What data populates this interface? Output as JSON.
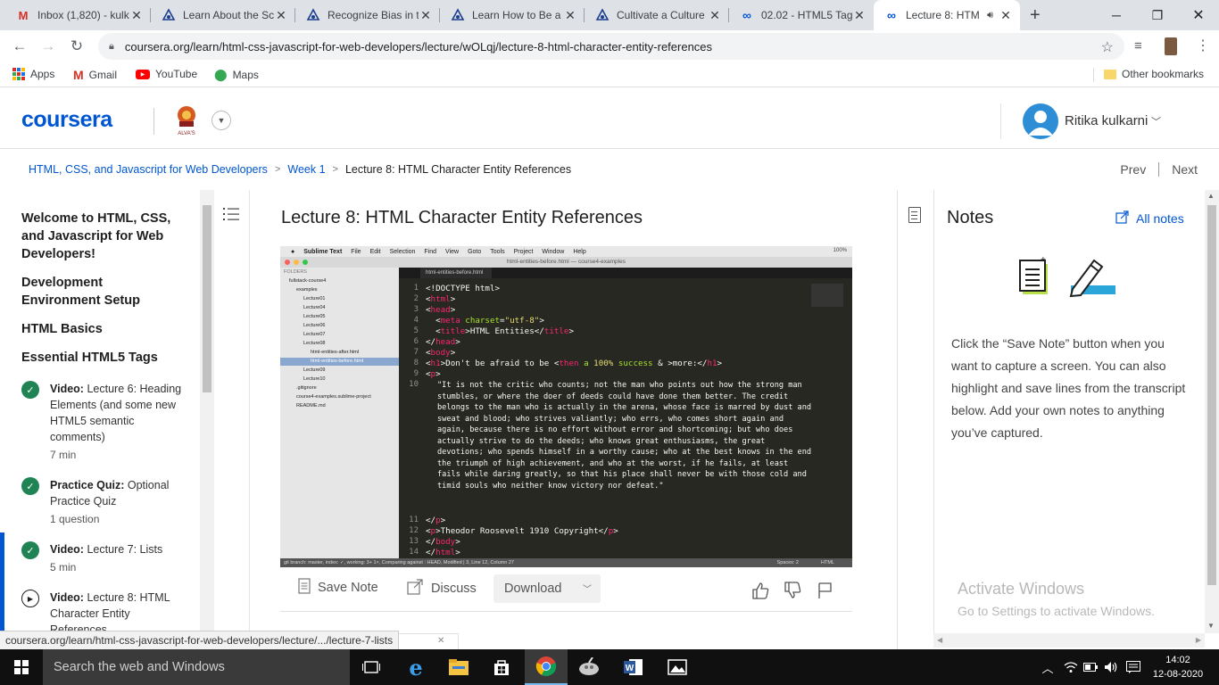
{
  "browser": {
    "tabs": [
      {
        "title": "Inbox (1,820) - kulk",
        "favicon": "gmail-icon"
      },
      {
        "title": "Learn About the Sc",
        "favicon": "coursera-badge-icon"
      },
      {
        "title": "Recognize Bias in t",
        "favicon": "coursera-badge-icon"
      },
      {
        "title": "Learn How to Be a",
        "favicon": "coursera-badge-icon"
      },
      {
        "title": "Cultivate a Culture",
        "favicon": "coursera-badge-icon"
      },
      {
        "title": "02.02 - HTML5 Tag",
        "favicon": "coursera-loop-icon"
      },
      {
        "title": "Lecture 8: HTM",
        "favicon": "coursera-loop-icon",
        "active": true
      }
    ],
    "new_tab_glyph": "+",
    "url": "coursera.org/learn/html-css-javascript-for-web-developers/lecture/wOLqj/lecture-8-html-character-entity-references",
    "bookmarks": [
      "Apps",
      "Gmail",
      "YouTube",
      "Maps"
    ],
    "other_bookmarks": "Other bookmarks"
  },
  "header": {
    "logo": "coursera",
    "institution": "ALVA'S",
    "user_name": "Ritika kulkarni"
  },
  "breadcrumb": {
    "course": "HTML, CSS, and Javascript for Web Developers",
    "week": "Week 1",
    "current": "Lecture 8: HTML Character Entity References",
    "prev": "Prev",
    "next": "Next"
  },
  "sidebar": {
    "sections": [
      "Welcome to HTML, CSS, and Javascript for Web Developers!",
      "Development Environment Setup",
      "HTML Basics",
      "Essential HTML5 Tags"
    ],
    "items": [
      {
        "kind": "Video:",
        "title": "Lecture 6: Heading Elements (and some new HTML5 semantic comments)",
        "meta": "7 min",
        "status": "done"
      },
      {
        "kind": "Practice Quiz:",
        "title": "Optional Practice Quiz",
        "meta": "1 question",
        "status": "done"
      },
      {
        "kind": "Video:",
        "title": "Lecture 7: Lists",
        "meta": "5 min",
        "status": "done"
      },
      {
        "kind": "Video:",
        "title": "Lecture 8: HTML Character Entity References",
        "meta": "",
        "status": "current"
      }
    ]
  },
  "lecture": {
    "title": "Lecture 8: HTML Character Entity References",
    "video": {
      "menubar": [
        "Sublime Text",
        "File",
        "Edit",
        "Selection",
        "Find",
        "View",
        "Goto",
        "Tools",
        "Project",
        "Window",
        "Help"
      ],
      "menubar_right": "100%",
      "window_title": "html-entities-before.html — course4-examples",
      "folders_header": "FOLDERS",
      "folders": [
        "fullstack-course4",
        "examples",
        "Lecture01",
        "Lecture04",
        "Lecture05",
        "Lecture06",
        "Lecture07",
        "Lecture08",
        "html-entities-after.html",
        "html-entities-before.html",
        "Lecture09",
        "Lecture10",
        ".gitignore",
        "course4-examples.sublime-project",
        "README.md"
      ],
      "editor_tab": "html-entities-before.html",
      "line_numbers": [
        "1",
        "2",
        "3",
        "4",
        "5",
        "6",
        "7",
        "8",
        "9",
        "10",
        "11",
        "12",
        "13",
        "14"
      ],
      "quote": "\"It is not the critic who counts; not the man who points out how the strong man stumbles, or where the doer of deeds could have done them better. The credit belongs to the man who is actually in the arena, whose face is marred by dust and sweat and blood; who strives valiantly; who errs, who comes short again and again, because there is no effort without error and shortcoming; but who does actually strive to do the deeds; who knows great enthusiasms, the great devotions; who spends himself in a worthy cause; who at the best knows in the end the triumph of high achievement, and who at the worst, if he fails, at least fails while daring greatly, so that his place shall never be with those cold and timid souls who neither know victory nor defeat.\"",
      "status_left": "git branch: master, index: ✓, working: 3+ 1×, Comparing against : HEAD, Modified | 3, Line 12, Column 27",
      "status_spaces": "Spaces: 2",
      "status_syntax": "HTML"
    },
    "actions": {
      "save_note": "Save Note",
      "discuss": "Discuss",
      "download": "Download"
    }
  },
  "notes": {
    "title": "Notes",
    "all_notes": "All notes",
    "help_text": "Click the “Save Note” button when you want to capture a screen. You can also highlight and save lines from the transcript below. Add your own notes to anything you’ve captured."
  },
  "watermark": {
    "line1": "Activate Windows",
    "line2": "Go to Settings to activate Windows."
  },
  "status_url": "coursera.org/learn/html-css-javascript-for-web-developers/lecture/.../lecture-7-lists",
  "taskbar": {
    "search_placeholder": "Search the web and Windows",
    "time": "14:02",
    "date": "12-08-2020"
  },
  "colors": {
    "coursera_blue": "#0056d2",
    "done_green": "#1f8354"
  }
}
